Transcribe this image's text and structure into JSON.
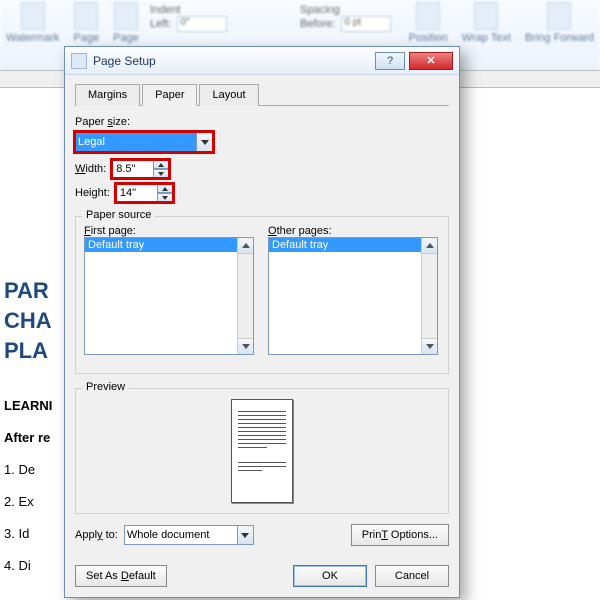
{
  "ribbon": {
    "groups_left": [
      "Watermark",
      "Page",
      "Page"
    ],
    "indent_label": "Indent",
    "indent_left_label": "Left:",
    "indent_left_value": "0\"",
    "spacing_label": "Spacing",
    "spacing_before_label": "Before:",
    "spacing_before_value": "0 pt",
    "right_items": [
      "Position",
      "Wrap Text",
      "Bring Forward"
    ]
  },
  "dialog": {
    "title": "Page Setup",
    "tabs": {
      "margins": "Margins",
      "paper": "Paper",
      "layout": "Layout"
    },
    "paper_size_label": "Paper size:",
    "paper_size_accel": "s",
    "paper_size_value": "Legal",
    "width_label": "Width:",
    "width_accel": "W",
    "width_value": "8.5\"",
    "height_label": "Height:",
    "height_accel": "g",
    "height_value": "14\"",
    "paper_source_label": "Paper source",
    "first_page_label": "First page:",
    "first_page_accel": "F",
    "other_pages_label": "Other pages:",
    "other_pages_accel": "O",
    "tray_item": "Default tray",
    "preview_label": "Preview",
    "apply_to_label": "Apply to:",
    "apply_to_accel": "y",
    "apply_to_value": "Whole document",
    "print_options": "Print Options...",
    "print_options_accel": "T",
    "set_default": "Set As Default",
    "set_default_accel": "D",
    "ok": "OK",
    "cancel": "Cancel"
  },
  "doc": {
    "part": "PAR",
    "chap": "CHA",
    "plan": "PLA",
    "learning": "LEARNI",
    "after": "After re",
    "li1": "1.     De",
    "li2": "2.     Ex",
    "li3": "3.     Id",
    "li4": "4.     Di"
  }
}
